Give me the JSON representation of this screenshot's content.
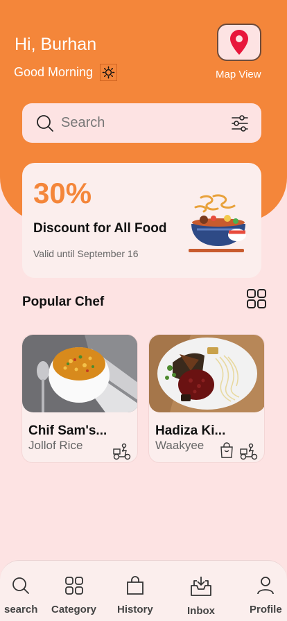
{
  "header": {
    "greeting": "Hi, Burhan",
    "subgreeting": "Good Morning",
    "map_label": "Map View",
    "colors": {
      "accent": "#f4863a",
      "pin": "#e8173c"
    }
  },
  "search": {
    "placeholder": "Search"
  },
  "promo": {
    "percent": "30%",
    "title": "Discount for All Food",
    "valid": "Valid until September 16"
  },
  "section": {
    "title": "Popular Chef"
  },
  "chefs": [
    {
      "name": "Chif Sam's...",
      "dish": "Jollof Rice",
      "icons": [
        "delivery-scooter-icon"
      ]
    },
    {
      "name": "Hadiza Ki...",
      "dish": "Waakyee",
      "icons": [
        "shopping-bag-icon",
        "delivery-scooter-icon"
      ]
    }
  ],
  "nav": [
    {
      "label": "search",
      "icon": "search-icon"
    },
    {
      "label": "Category",
      "icon": "grid-icon"
    },
    {
      "label": "History",
      "icon": "bag-icon"
    },
    {
      "label": "Inbox",
      "icon": "inbox-icon"
    },
    {
      "label": "Profile",
      "icon": "user-icon"
    }
  ]
}
